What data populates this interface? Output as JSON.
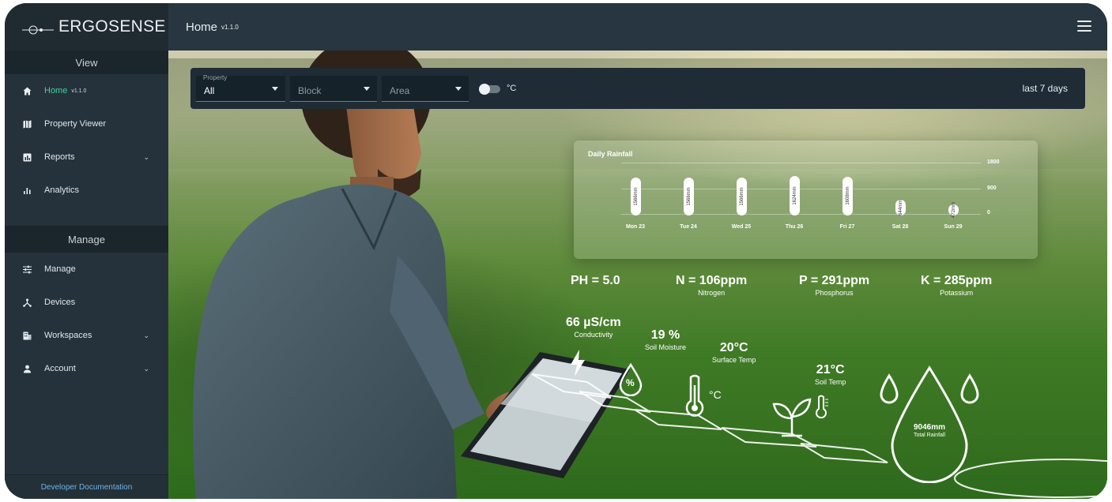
{
  "brand": {
    "name": "ERGOSENSE"
  },
  "header": {
    "title": "Home",
    "version": "v1.1.0",
    "menu_icon": "hamburger-icon"
  },
  "sidebar": {
    "view_heading": "View",
    "view_items": [
      {
        "label": "Home",
        "version": "v1.1.0",
        "icon": "home-icon",
        "active": true
      },
      {
        "label": "Property Viewer",
        "icon": "map-icon"
      },
      {
        "label": "Reports",
        "icon": "report-icon",
        "expandable": true
      },
      {
        "label": "Analytics",
        "icon": "bar-chart-icon"
      }
    ],
    "manage_heading": "Manage",
    "manage_items": [
      {
        "label": "Manage",
        "icon": "sliders-icon"
      },
      {
        "label": "Devices",
        "icon": "devices-icon"
      },
      {
        "label": "Workspaces",
        "icon": "building-icon",
        "expandable": true
      },
      {
        "label": "Account",
        "icon": "person-icon",
        "expandable": true
      }
    ],
    "footer_link": "Developer Documentation"
  },
  "filters": {
    "property_label": "Property",
    "property_value": "All",
    "block_value": "Block",
    "area_value": "Area",
    "unit_label": "°C",
    "range": "last 7 days"
  },
  "rainfall": {
    "title": "Daily Rainfall",
    "y_ticks": [
      "1800",
      "900",
      "0"
    ],
    "days": [
      {
        "day": "Mon 23",
        "label": "1566mm",
        "value": 1566
      },
      {
        "day": "Tue 24",
        "label": "1566mm",
        "value": 1566
      },
      {
        "day": "Wed 25",
        "label": "1566mm",
        "value": 1566
      },
      {
        "day": "Thu 26",
        "label": "1624mm",
        "value": 1624
      },
      {
        "day": "Fri 27",
        "label": "1608mm",
        "value": 1608
      },
      {
        "day": "Sat 28",
        "label": "644mm",
        "value": 644
      },
      {
        "day": "Sun 29",
        "label": "472mm",
        "value": 472
      }
    ]
  },
  "metrics": {
    "ph": {
      "value": "PH = 5.0"
    },
    "n": {
      "value": "N = 106ppm",
      "sub": "Nitrogen"
    },
    "p": {
      "value": "P = 291ppm",
      "sub": "Phosphorus"
    },
    "k": {
      "value": "K = 285ppm",
      "sub": "Potassium"
    },
    "conductivity": {
      "value": "66 µS/cm",
      "sub": "Conductivity"
    },
    "moisture": {
      "value": "19 %",
      "sub": "Soil Moisture"
    },
    "surface_temp": {
      "value": "20°C",
      "sub": "Surface Temp"
    },
    "soil_temp": {
      "value": "21°C",
      "sub": "Soil Temp"
    },
    "total_rainfall": {
      "value": "9046mm",
      "sub": "Total Rainfall"
    }
  },
  "icon_labels": {
    "percent": "%",
    "celsius": "°C"
  },
  "colors": {
    "accent": "#3fd19a",
    "sidebar": "#26323b",
    "header": "#273640",
    "link": "#6fb3e8"
  }
}
